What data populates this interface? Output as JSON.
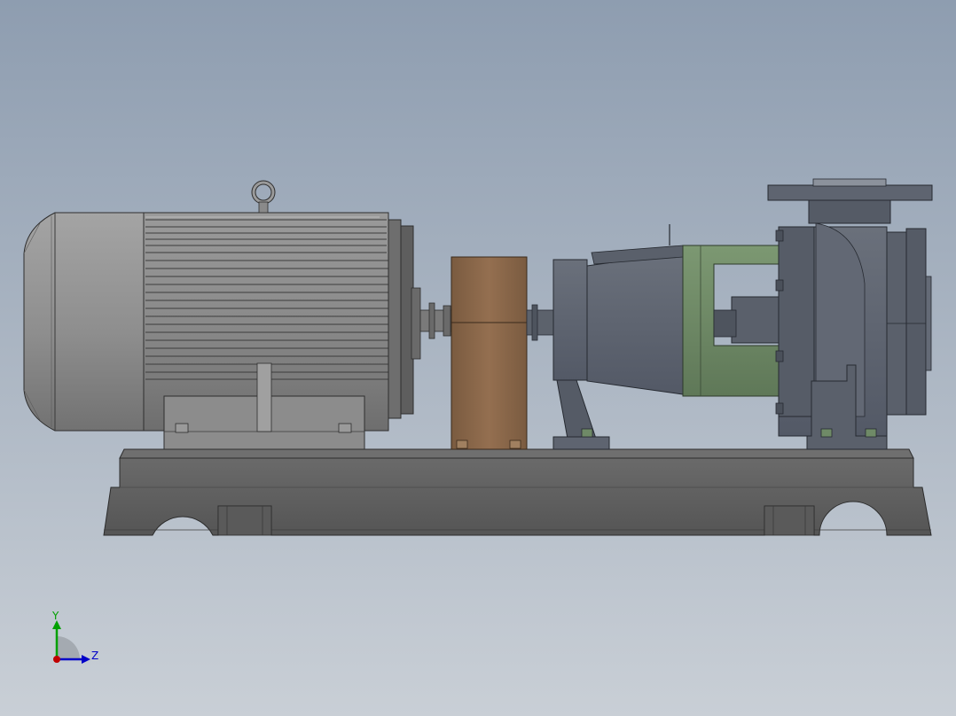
{
  "viewport": {
    "background_top": "#8e9db0",
    "background_bottom": "#c9cfd6"
  },
  "colors": {
    "motor_gray": "#8a8a8a",
    "pump_slate": "#5e6470",
    "coupling_guard_brown": "#8a6a4c",
    "bracket_green": "#6f8a67",
    "baseplate_dark": "#5c5c5c"
  },
  "triad": {
    "y_label": "Y",
    "z_label": "Z",
    "x_color": "#c00000",
    "y_color": "#00a000",
    "z_color": "#0000c8"
  },
  "icons": {
    "orientation": "axis-triad-icon"
  }
}
